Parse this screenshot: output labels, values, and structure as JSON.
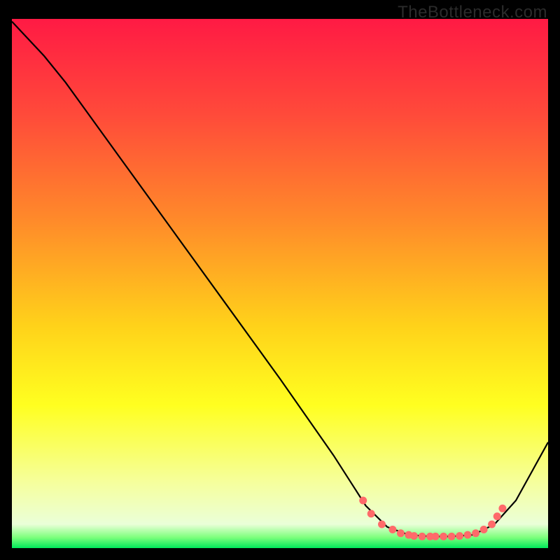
{
  "watermark": "TheBottleneck.com",
  "chart_data": {
    "type": "line",
    "title": "",
    "xlabel": "",
    "ylabel": "",
    "xlim": [
      0,
      100
    ],
    "ylim": [
      0,
      100
    ],
    "gradient": {
      "stops": [
        {
          "offset": 0.0,
          "color": "#ff1a44"
        },
        {
          "offset": 0.18,
          "color": "#ff4a3a"
        },
        {
          "offset": 0.38,
          "color": "#ff8a2a"
        },
        {
          "offset": 0.58,
          "color": "#ffd21a"
        },
        {
          "offset": 0.73,
          "color": "#ffff20"
        },
        {
          "offset": 0.88,
          "color": "#f5ffa0"
        },
        {
          "offset": 0.955,
          "color": "#eaffd8"
        },
        {
          "offset": 0.98,
          "color": "#7cff7c"
        },
        {
          "offset": 1.0,
          "color": "#00e85a"
        }
      ]
    },
    "series": [
      {
        "name": "curve",
        "type": "line",
        "color": "#000000",
        "x": [
          0.0,
          6.0,
          10.0,
          20.0,
          30.0,
          40.0,
          50.0,
          60.0,
          66.0,
          70.0,
          74.0,
          78.0,
          82.0,
          86.0,
          90.0,
          94.0,
          100.0
        ],
        "y": [
          99.5,
          93.0,
          88.0,
          74.0,
          60.0,
          46.0,
          32.0,
          17.5,
          8.0,
          4.0,
          2.5,
          2.2,
          2.2,
          2.5,
          4.5,
          9.0,
          20.0
        ]
      },
      {
        "name": "valley-dots",
        "type": "scatter",
        "color": "#ff6a6a",
        "x": [
          65.5,
          67.0,
          69.0,
          71.0,
          72.5,
          74.0,
          75.0,
          76.5,
          78.0,
          79.0,
          80.5,
          82.0,
          83.5,
          85.0,
          86.5,
          88.0,
          89.5,
          90.5,
          91.5
        ],
        "y": [
          9.0,
          6.5,
          4.5,
          3.5,
          2.8,
          2.5,
          2.3,
          2.2,
          2.2,
          2.2,
          2.2,
          2.2,
          2.3,
          2.5,
          2.8,
          3.5,
          4.5,
          6.0,
          7.5
        ]
      }
    ]
  }
}
